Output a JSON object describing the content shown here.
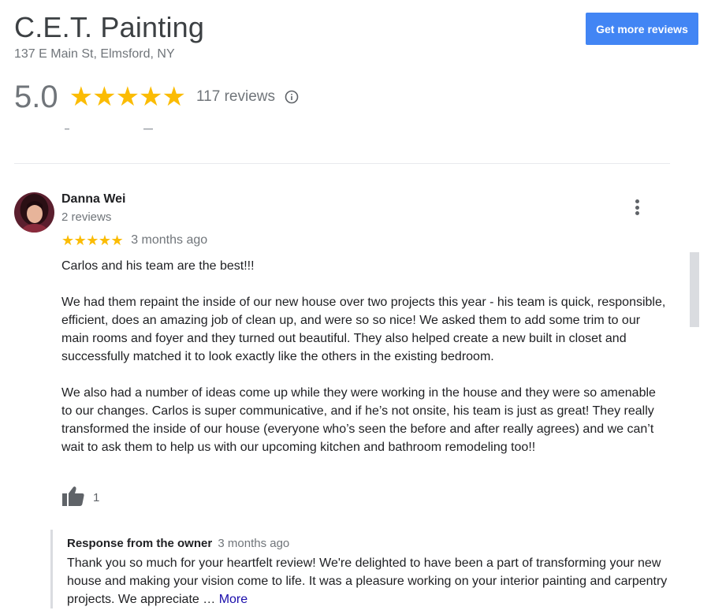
{
  "business": {
    "name": "C.E.T. Painting",
    "address": "137 E Main St, Elmsford, NY"
  },
  "cta": {
    "label": "Get more reviews"
  },
  "summary": {
    "rating": "5.0",
    "stars": "★★★★★",
    "rating_level": 5.0,
    "review_count": "117 reviews",
    "info_icon": "info-circle-icon"
  },
  "review": {
    "reviewer_name": "Danna Wei",
    "reviewer_meta": "2 reviews",
    "stars": "★★★★★",
    "rating_level": 5,
    "date": "3 months ago",
    "paragraphs": [
      "Carlos and his team are the best!!!",
      "We had them repaint the inside of our new house over two projects this year - his team is quick, responsible, efficient, does an amazing job of clean up, and were so so nice!  We asked them to add some trim to our main rooms and foyer and they turned out beautiful.  They also helped create a new built in closet and successfully matched it to look exactly like the others in the existing bedroom.",
      "We also had a number of ideas come up while they were working in the house and they were so amenable to our changes.  Carlos is super communicative, and if he’s not onsite, his team is just as great!  They really transformed the inside of our house (everyone who’s seen the before and after really agrees) and we can’t wait to ask them to help us with our upcoming kitchen and bathroom remodeling too!!"
    ],
    "like_count": "1",
    "like_icon": "thumbs-up-icon",
    "menu_icon": "more-vert-icon"
  },
  "owner_response": {
    "label": "Response from the owner",
    "date": "3 months ago",
    "text": "Thank you so much for your heartfelt review! We're delighted to have been a part of transforming your new house and making your vision come to life. It was a pleasure working on your interior painting and carpentry projects. We appreciate …",
    "more_label": "More"
  },
  "colors": {
    "accent": "#4285f4",
    "star": "#fbbc04",
    "link": "#1a0dab",
    "muted_text": "#70757a"
  }
}
